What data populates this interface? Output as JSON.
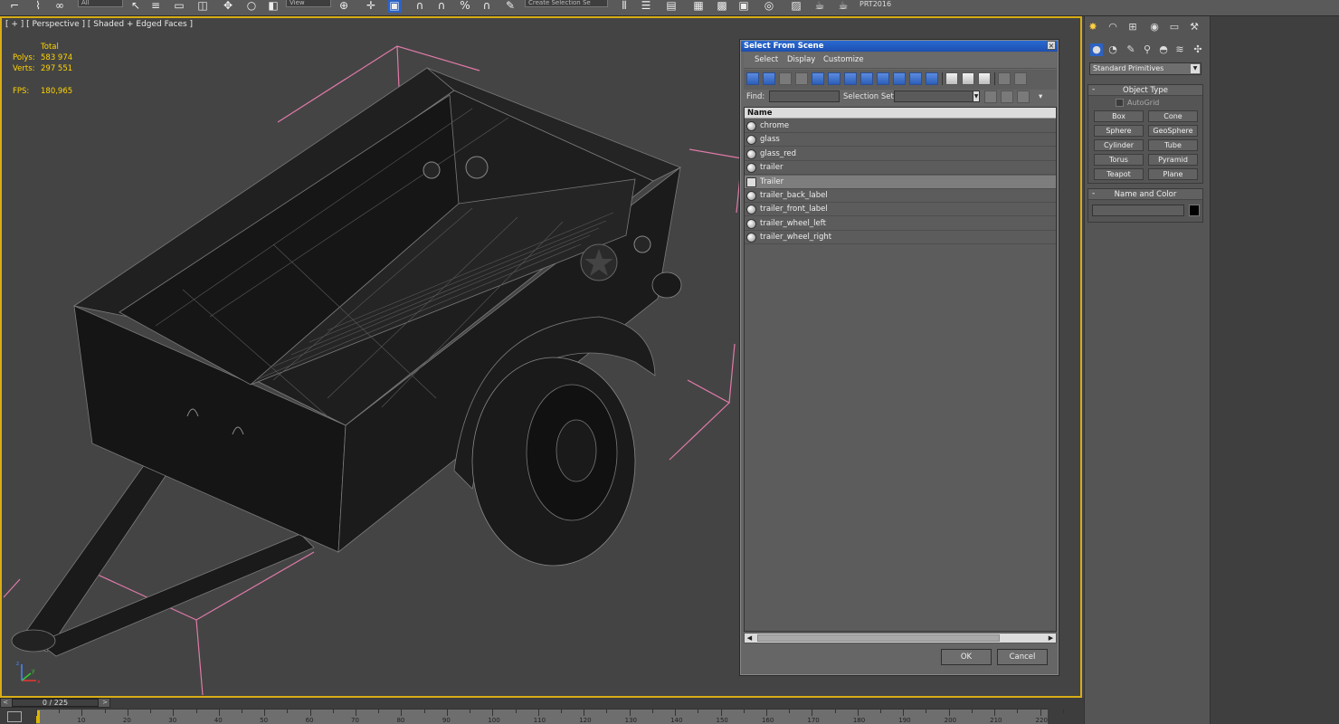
{
  "toolbar": {
    "dropdown_all": "All",
    "dropdown_view": "View",
    "selection_set_placeholder": "Create Selection Se",
    "prt_label": "PRT2016"
  },
  "viewport": {
    "label": "[ + ] [ Perspective ] [ Shaded + Edged Faces ]",
    "stats": {
      "total_label": "Total",
      "polys_label": "Polys:",
      "polys_value": "583 974",
      "verts_label": "Verts:",
      "verts_value": "297 551",
      "fps_label": "FPS:",
      "fps_value": "180,965"
    },
    "axis_labels": {
      "x": "x",
      "y": "y",
      "z": "z"
    }
  },
  "dialog": {
    "title": "Select From Scene",
    "close_glyph": "×",
    "menu": [
      "Select",
      "Display",
      "Customize"
    ],
    "find_label": "Find:",
    "find_value": "",
    "selection_set_label": "Selection Set:",
    "selection_set_value": "",
    "column_header": "Name",
    "items": [
      {
        "label": "chrome",
        "icon": "sphere-icon",
        "selected": false
      },
      {
        "label": "glass",
        "icon": "sphere-icon",
        "selected": false
      },
      {
        "label": "glass_red",
        "icon": "sphere-icon",
        "selected": false
      },
      {
        "label": "trailer",
        "icon": "sphere-icon",
        "selected": false
      },
      {
        "label": "Trailer",
        "icon": "group-icon",
        "selected": true
      },
      {
        "label": "trailer_back_label",
        "icon": "sphere-icon",
        "selected": false
      },
      {
        "label": "trailer_front_label",
        "icon": "sphere-icon",
        "selected": false
      },
      {
        "label": "trailer_wheel_left",
        "icon": "sphere-icon",
        "selected": false
      },
      {
        "label": "trailer_wheel_right",
        "icon": "sphere-icon",
        "selected": false
      }
    ],
    "ok_label": "OK",
    "cancel_label": "Cancel"
  },
  "command_panel": {
    "dropdown": "Standard Primitives",
    "object_type_title": "Object Type",
    "autogrid_label": "AutoGrid",
    "autogrid_checked": false,
    "primitives": [
      "Box",
      "Cone",
      "Sphere",
      "GeoSphere",
      "Cylinder",
      "Tube",
      "Torus",
      "Pyramid",
      "Teapot",
      "Plane"
    ],
    "name_color_title": "Name and Color",
    "name_value": "",
    "object_color": "#000000"
  },
  "timeline": {
    "frame_display": "0 / 225",
    "ruler_labels": [
      "10",
      "20",
      "30",
      "40",
      "50",
      "60",
      "70",
      "80",
      "90",
      "100",
      "110",
      "120",
      "130",
      "140",
      "150",
      "160",
      "170",
      "180",
      "190",
      "200",
      "210",
      "220"
    ]
  },
  "colors": {
    "viewport_border": "#d8ad16",
    "stats_text": "#ffd400",
    "bounding_box": "#e07aa8",
    "dialog_title": "#1e4fb0"
  }
}
